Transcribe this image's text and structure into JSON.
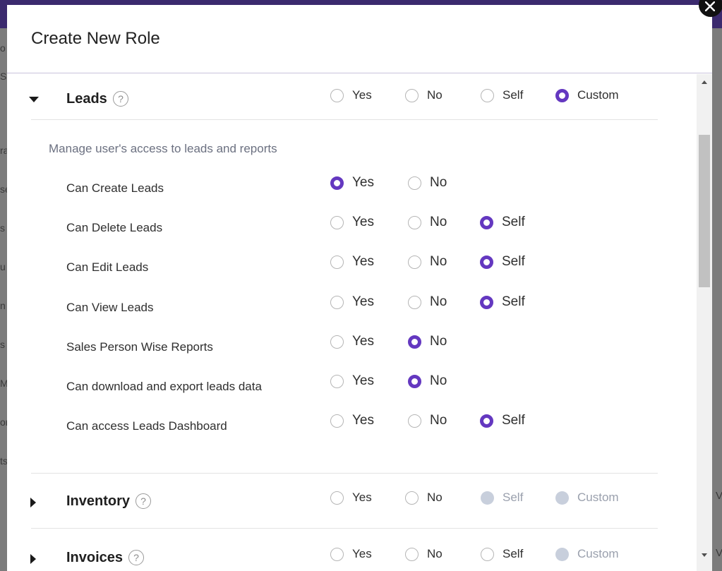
{
  "modal": {
    "title": "Create New Role",
    "close_icon": "close-icon"
  },
  "background": {
    "left_peek": [
      "o",
      "S",
      "ra",
      "se",
      "s a",
      "u",
      "n",
      "s",
      "M",
      "or",
      "ts"
    ],
    "right_peek": [
      "V",
      "V"
    ]
  },
  "option_labels": {
    "yes": "Yes",
    "no": "No",
    "self": "Self",
    "custom": "Custom"
  },
  "sections": [
    {
      "title": "Leads",
      "expanded": true,
      "selected": "custom",
      "disabled": [],
      "description": "Manage user's access to leads and reports",
      "permissions": [
        {
          "label": "Can Create Leads",
          "options": [
            "yes",
            "no"
          ],
          "selected": "yes"
        },
        {
          "label": "Can Delete Leads",
          "options": [
            "yes",
            "no",
            "self"
          ],
          "selected": "self"
        },
        {
          "label": "Can Edit Leads",
          "options": [
            "yes",
            "no",
            "self"
          ],
          "selected": "self"
        },
        {
          "label": "Can View Leads",
          "options": [
            "yes",
            "no",
            "self"
          ],
          "selected": "self"
        },
        {
          "label": "Sales Person Wise Reports",
          "options": [
            "yes",
            "no"
          ],
          "selected": "no"
        },
        {
          "label": "Can download and export leads data",
          "options": [
            "yes",
            "no"
          ],
          "selected": "no"
        },
        {
          "label": "Can access Leads Dashboard",
          "options": [
            "yes",
            "no",
            "self"
          ],
          "selected": "self"
        }
      ]
    },
    {
      "title": "Inventory",
      "expanded": false,
      "selected": null,
      "disabled": [
        "self",
        "custom"
      ]
    },
    {
      "title": "Invoices",
      "expanded": false,
      "selected": null,
      "disabled": [
        "custom"
      ]
    }
  ],
  "colors": {
    "accent": "#6438c0",
    "disabled_radio": "#c8cfdc"
  }
}
